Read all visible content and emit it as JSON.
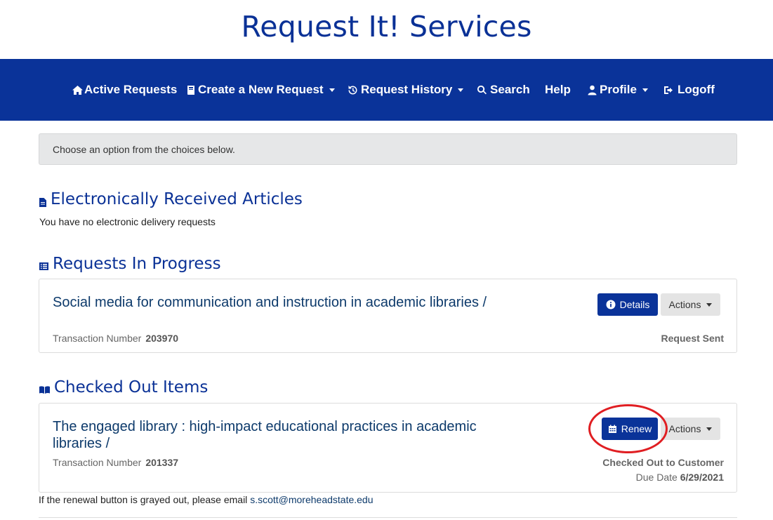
{
  "header": {
    "title": "Request It! Services"
  },
  "nav": {
    "active_requests": "Active Requests",
    "create_request": "Create a New Request",
    "request_history": "Request History",
    "search": "Search",
    "help": "Help",
    "profile": "Profile",
    "logoff": "Logoff"
  },
  "alert": {
    "text": "Choose an option from the choices below."
  },
  "electronic": {
    "title": "Electronically Received Articles",
    "empty_text": "You have no electronic delivery requests"
  },
  "in_progress": {
    "title": "Requests In Progress",
    "item": {
      "title": "Social media for communication and instruction in academic libraries /",
      "txn_label": "Transaction Number",
      "txn_number": "203970",
      "details_label": "Details",
      "actions_label": "Actions",
      "status": "Request Sent"
    }
  },
  "checked_out": {
    "title": "Checked Out Items",
    "item": {
      "title": "The engaged library : high-impact educational practices in academic libraries /",
      "txn_label": "Transaction Number",
      "txn_number": "201337",
      "renew_label": "Renew",
      "actions_label": "Actions",
      "status": "Checked Out to Customer",
      "due_label": "Due Date",
      "due_date": "6/29/2021"
    }
  },
  "footnote": {
    "text": "If the renewal button is grayed out, please email ",
    "email": "s.scott@moreheadstate.edu"
  },
  "colors": {
    "brand_blue": "#0a3399",
    "highlight_red": "#e01e22"
  }
}
